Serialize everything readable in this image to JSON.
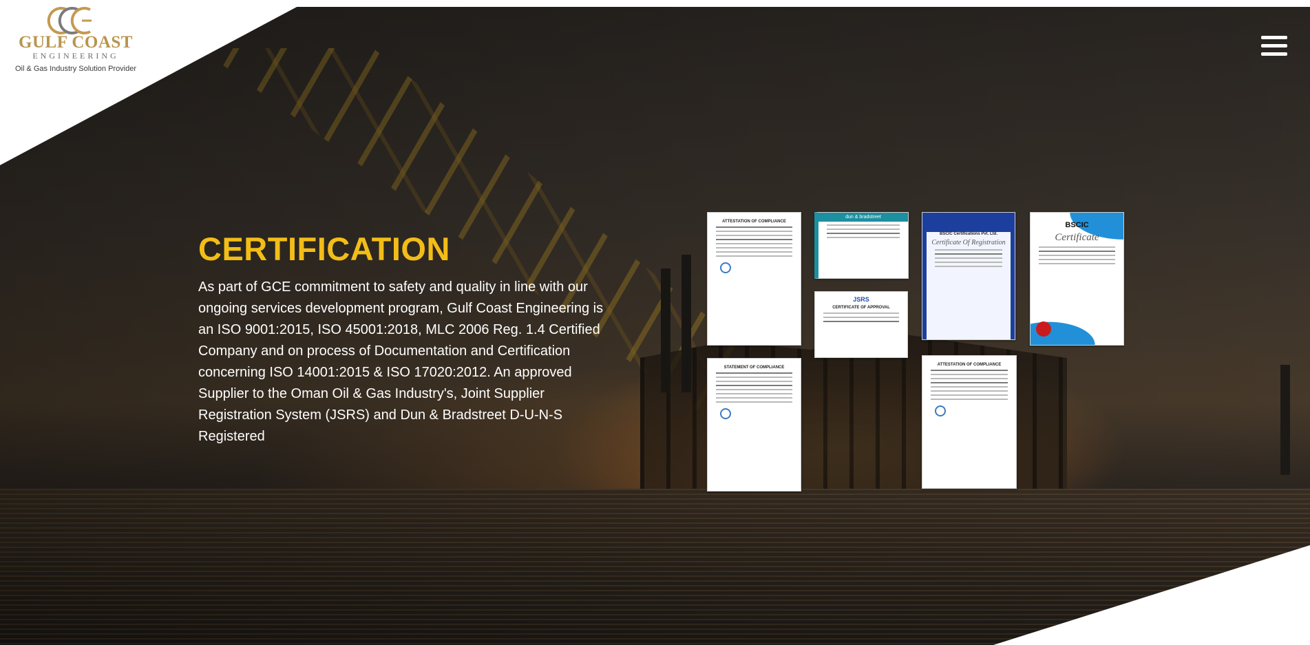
{
  "header": {
    "logo": {
      "monogram": "GCE",
      "name": "GULF COAST",
      "subtitle": "ENGINEERING",
      "tagline": "Oil & Gas Industry Solution Provider",
      "colors": {
        "gold": "#b8954e",
        "gray": "#6c6c6c"
      }
    },
    "menu_icon": "hamburger-menu-icon"
  },
  "section": {
    "title": "CERTIFICATION",
    "body": "As part of GCE commitment to safety and quality in line with our ongoing services development program, Gulf Coast Engineering is an ISO 9001:2015, ISO 45001:2018, MLC 2006 Reg. 1.4 Certified Company and  on process of Documentation and Certification concerning ISO 14001:2015 & ISO 17020:2012.  An approved Supplier to the Oman Oil & Gas Industry's, Joint Supplier Registration System (JSRS) and Dun & Bradstreet D-U-N-S Registered",
    "colors": {
      "title": "#f3bd17",
      "body": "#ffffff"
    }
  },
  "certificates": [
    {
      "heading": "ATTESTATION OF COMPLIANCE"
    },
    {
      "heading": "dun & bradstreet"
    },
    {
      "heading": "BSCIC Certifications Pvt. Ltd.",
      "subheading": "Certificate Of Registration"
    },
    {
      "heading": "BSCIC",
      "subheading": "Certificate"
    },
    {
      "heading": "JSRS",
      "subheading": "CERTIFICATE OF APPROVAL"
    },
    {
      "heading": "STATEMENT OF COMPLIANCE"
    },
    {
      "heading": "ATTESTATION OF COMPLIANCE"
    }
  ]
}
